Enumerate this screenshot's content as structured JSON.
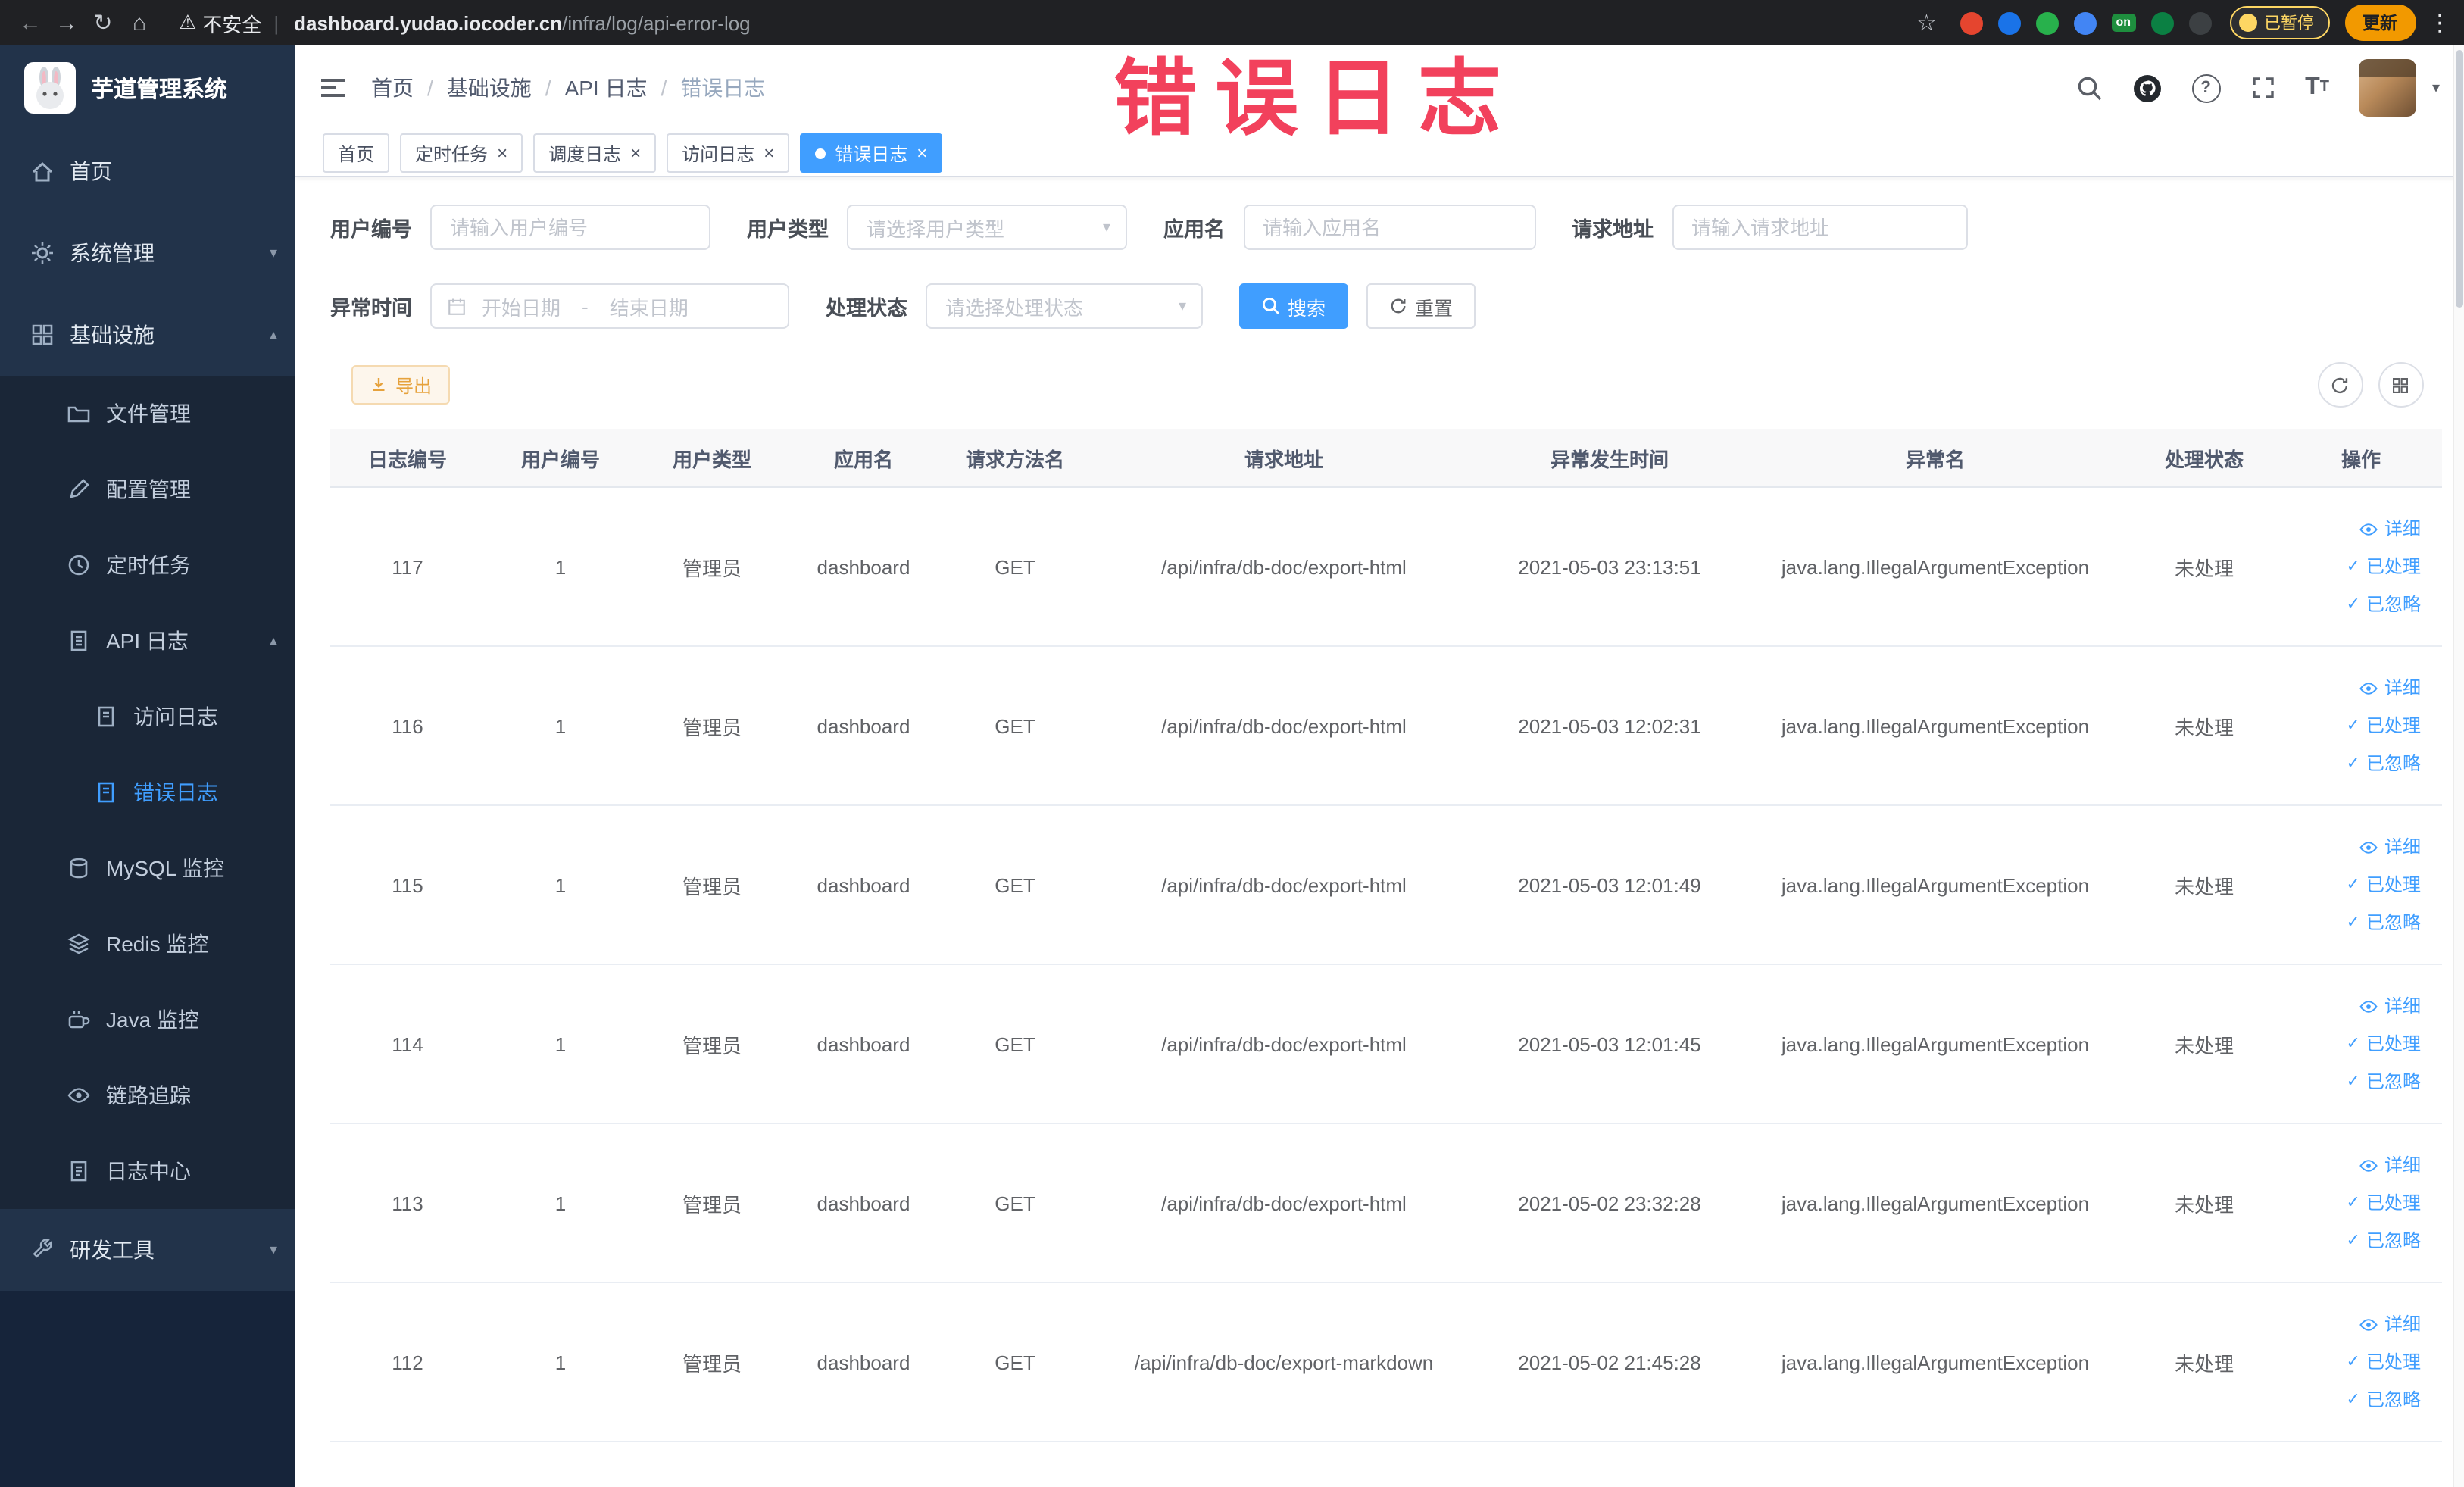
{
  "browser": {
    "security": "不安全",
    "url_domain": "dashboard.yudao.iocoder.cn",
    "url_path": "/infra/log/api-error-log",
    "paused_badge": "已暂停",
    "on_badge": "on",
    "update_button": "更新"
  },
  "watermark": "错误日志",
  "sidebar": {
    "title": "芋道管理系统",
    "items": [
      {
        "label": "首页"
      },
      {
        "label": "系统管理"
      },
      {
        "label": "基础设施"
      },
      {
        "label": "文件管理"
      },
      {
        "label": "配置管理"
      },
      {
        "label": "定时任务"
      },
      {
        "label": "API 日志"
      },
      {
        "label": "访问日志"
      },
      {
        "label": "错误日志"
      },
      {
        "label": "MySQL 监控"
      },
      {
        "label": "Redis 监控"
      },
      {
        "label": "Java 监控"
      },
      {
        "label": "链路追踪"
      },
      {
        "label": "日志中心"
      },
      {
        "label": "研发工具"
      }
    ]
  },
  "breadcrumb": [
    "首页",
    "基础设施",
    "API 日志",
    "错误日志"
  ],
  "tabs": [
    {
      "label": "首页"
    },
    {
      "label": "定时任务"
    },
    {
      "label": "调度日志"
    },
    {
      "label": "访问日志"
    },
    {
      "label": "错误日志"
    }
  ],
  "filters": {
    "user_id_label": "用户编号",
    "user_id_placeholder": "请输入用户编号",
    "user_type_label": "用户类型",
    "user_type_placeholder": "请选择用户类型",
    "app_name_label": "应用名",
    "app_name_placeholder": "请输入应用名",
    "request_url_label": "请求地址",
    "request_url_placeholder": "请输入请求地址",
    "time_label": "异常时间",
    "time_start_placeholder": "开始日期",
    "time_separator": "-",
    "time_end_placeholder": "结束日期",
    "status_label": "处理状态",
    "status_placeholder": "请选择处理状态",
    "search": "搜索",
    "reset": "重置"
  },
  "toolbar": {
    "export": "导出"
  },
  "table": {
    "columns": [
      "日志编号",
      "用户编号",
      "用户类型",
      "应用名",
      "请求方法名",
      "请求地址",
      "异常发生时间",
      "异常名",
      "处理状态",
      "操作"
    ],
    "actions": {
      "detail": "详细",
      "done": "已处理",
      "ignore": "已忽略"
    },
    "rows": [
      {
        "id": "117",
        "user_id": "1",
        "user_type": "管理员",
        "app": "dashboard",
        "method": "GET",
        "url": "/api/infra/db-doc/export-html",
        "time": "2021-05-03 23:13:51",
        "exception": "java.lang.IllegalArgumentException",
        "status": "未处理"
      },
      {
        "id": "116",
        "user_id": "1",
        "user_type": "管理员",
        "app": "dashboard",
        "method": "GET",
        "url": "/api/infra/db-doc/export-html",
        "time": "2021-05-03 12:02:31",
        "exception": "java.lang.IllegalArgumentException",
        "status": "未处理"
      },
      {
        "id": "115",
        "user_id": "1",
        "user_type": "管理员",
        "app": "dashboard",
        "method": "GET",
        "url": "/api/infra/db-doc/export-html",
        "time": "2021-05-03 12:01:49",
        "exception": "java.lang.IllegalArgumentException",
        "status": "未处理"
      },
      {
        "id": "114",
        "user_id": "1",
        "user_type": "管理员",
        "app": "dashboard",
        "method": "GET",
        "url": "/api/infra/db-doc/export-html",
        "time": "2021-05-03 12:01:45",
        "exception": "java.lang.IllegalArgumentException",
        "status": "未处理"
      },
      {
        "id": "113",
        "user_id": "1",
        "user_type": "管理员",
        "app": "dashboard",
        "method": "GET",
        "url": "/api/infra/db-doc/export-html",
        "time": "2021-05-02 23:32:28",
        "exception": "java.lang.IllegalArgumentException",
        "status": "未处理"
      },
      {
        "id": "112",
        "user_id": "1",
        "user_type": "管理员",
        "app": "dashboard",
        "method": "GET",
        "url": "/api/infra/db-doc/export-markdown",
        "time": "2021-05-02 21:45:28",
        "exception": "java.lang.IllegalArgumentException",
        "status": "未处理"
      }
    ]
  },
  "colors": {
    "accent": "#409EFF",
    "warning": "#e6a23c",
    "watermark": "#f2415c",
    "sidebar": "#22334a"
  }
}
